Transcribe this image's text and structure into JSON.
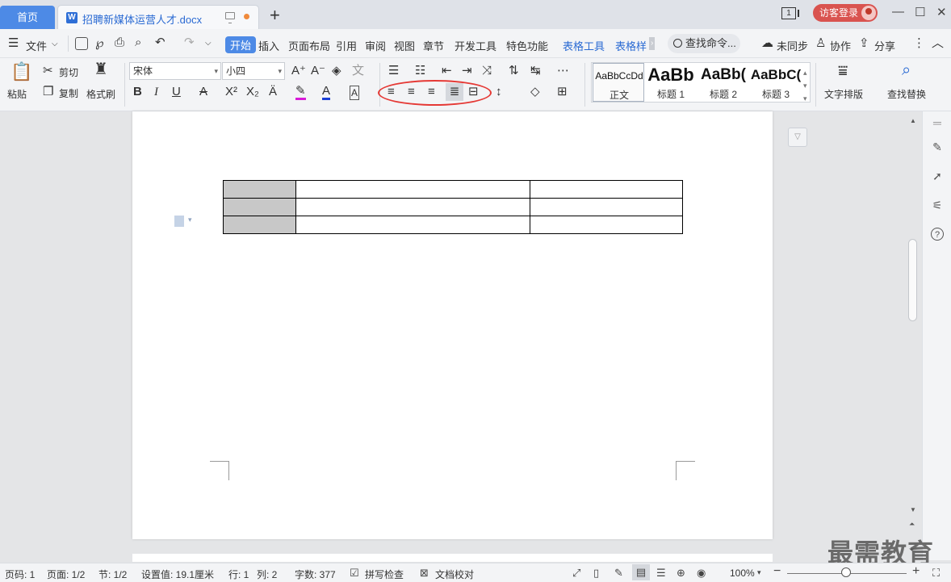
{
  "tabs": {
    "home": "首页",
    "doc_title": "招聘新媒体运营人才.docx",
    "add": "+"
  },
  "window": {
    "num": "1",
    "login": "访客登录",
    "minimize": "—",
    "restore": "☐",
    "close": "✕"
  },
  "menu": {
    "file": "文件",
    "items": [
      "开始",
      "插入",
      "页面布局",
      "引用",
      "审阅",
      "视图",
      "章节",
      "开发工具",
      "特色功能"
    ],
    "table_tools": "表格工具",
    "table_style": "表格样",
    "search": "查找命令...",
    "sync": "未同步",
    "collab": "协作",
    "share": "分享"
  },
  "ribbon": {
    "paste": "粘贴",
    "cut": "剪切",
    "copy": "复制",
    "format_painter": "格式刷",
    "font_name": "宋体",
    "font_size": "小四",
    "styles": [
      {
        "sample": "AaBbCcDd",
        "name": "正文"
      },
      {
        "sample": "AaBb",
        "name": "标题 1"
      },
      {
        "sample": "AaBb(",
        "name": "标题 2"
      },
      {
        "sample": "AaBbC(",
        "name": "标题 3"
      }
    ],
    "text_layout": "文字排版",
    "find_replace": "查找替换"
  },
  "status": {
    "page": "页码: 1",
    "pages": "页面: 1/2",
    "section": "节: 1/2",
    "position": "设置值: 19.1厘米",
    "row": "行: 1",
    "col": "列: 2",
    "words": "字数: 377",
    "spell": "拼写检查",
    "proof": "文档校对",
    "zoom": "100%"
  },
  "watermark": "最需教育"
}
